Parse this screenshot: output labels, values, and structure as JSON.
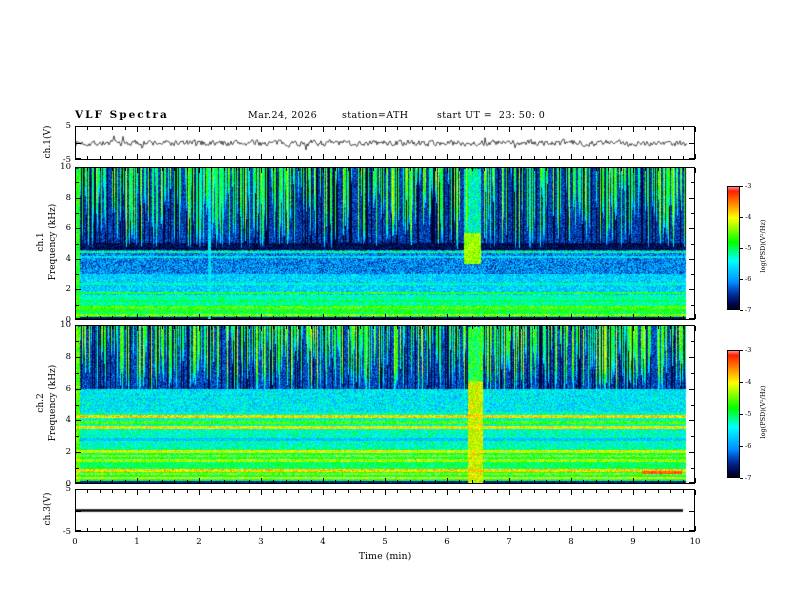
{
  "header": {
    "title": "VLF Spectra",
    "date": "Mar.24, 2026",
    "station": "station=ATH",
    "start_ut": "start UT =  23: 50: 0"
  },
  "axes": {
    "time": {
      "label": "Time (min)",
      "min": 0,
      "max": 10,
      "ticks": [
        0,
        1,
        2,
        3,
        4,
        5,
        6,
        7,
        8,
        9,
        10
      ]
    }
  },
  "colors": {
    "frame": "#000000",
    "background": "#ffffff"
  },
  "chart_data": [
    {
      "id": "ch1_waveform",
      "type": "line",
      "ylabel": "ch.1(V)",
      "ylim": [
        -5,
        5
      ],
      "yticks": [
        5,
        -5
      ],
      "line_color": "#000000",
      "line_width": 0.7,
      "noise_amplitude_v": 0.9,
      "spike_rate": 0.018,
      "spike_amplitude_v": 2.2,
      "seed": 7,
      "data_end_t": 9.9
    },
    {
      "id": "ch1_spectrogram",
      "type": "heatmap",
      "ylabel_lines": [
        "ch.1",
        "Frequency (kHz)"
      ],
      "ylim": [
        0,
        10
      ],
      "yticks": [
        10,
        8,
        6,
        4,
        2,
        0
      ],
      "colorbar": {
        "label": "log(PSD)(V²/Hz)",
        "ticks": [
          -3,
          -4,
          -5,
          -6,
          -7
        ],
        "min": -7,
        "max": -3
      },
      "seed": 11,
      "base_psd": -6.45,
      "noise": 0.3,
      "data_end_t": 9.87,
      "streaks": {
        "density": 0.5,
        "top": 10,
        "bottom_min": 4.7,
        "bottom_max": 9.2,
        "v_min": -5.3,
        "v_max": -4.2
      },
      "dark_columns": {
        "density": 0.22,
        "above_f": 5.05,
        "v": -6.9
      },
      "regions": [
        {
          "f0": 4.6,
          "f1": 5.05,
          "v": -6.8,
          "noise": 0.3
        },
        {
          "f0": 3.0,
          "f1": 4.6,
          "v": -6.1,
          "noise": 0.5
        },
        {
          "f0": 1.6,
          "f1": 3.0,
          "v": -5.7,
          "noise": 0.45
        },
        {
          "f0": 0.95,
          "f1": 1.6,
          "v": -5.25,
          "noise": 0.4
        },
        {
          "f0": 0.18,
          "f1": 0.95,
          "v": -5.0,
          "noise": 0.45
        },
        {
          "f0": 0.0,
          "f1": 0.18,
          "v": -6.8,
          "noise": 0.2
        }
      ],
      "bands": [
        {
          "f": 4.45,
          "w": 0.07,
          "v": -5.2,
          "jitter": 0.7
        },
        {
          "f": 4.12,
          "w": 0.06,
          "v": -5.6,
          "jitter": 0.5
        },
        {
          "f": 2.35,
          "w": 0.08,
          "v": -5.3,
          "jitter": 0.5
        },
        {
          "f": 1.75,
          "w": 0.08,
          "v": -4.8,
          "jitter": 0.45
        },
        {
          "f": 1.25,
          "w": 0.07,
          "v": -5.0,
          "jitter": 0.4
        },
        {
          "f": 0.8,
          "w": 0.08,
          "v": -4.6,
          "jitter": 0.4
        },
        {
          "f": 0.55,
          "w": 0.07,
          "v": -4.8,
          "jitter": 0.4
        },
        {
          "f": 0.3,
          "w": 0.08,
          "v": -4.4,
          "jitter": 0.4
        }
      ],
      "events": [
        {
          "t0": 6.27,
          "t1": 6.55,
          "f0": 3.7,
          "f1": 5.7,
          "v": -4.3,
          "jitter": 0.4
        },
        {
          "t0": 6.27,
          "t1": 6.55,
          "f0": 5.7,
          "f1": 10,
          "v": -5.4,
          "jitter": 0.6
        },
        {
          "t0": 0.0,
          "t1": 0.06,
          "f0": 0,
          "f1": 10,
          "v": -4.8,
          "jitter": 0.4
        },
        {
          "t0": 2.13,
          "t1": 2.17,
          "f0": 0,
          "f1": 10,
          "v": -5.6,
          "jitter": 0.4
        }
      ]
    },
    {
      "id": "ch2_spectrogram",
      "type": "heatmap",
      "ylabel_lines": [
        "ch.2",
        "Frequency (kHz)"
      ],
      "ylim": [
        0,
        10
      ],
      "yticks": [
        10,
        8,
        6,
        4,
        2,
        0
      ],
      "colorbar": {
        "label": "log(PSD)(V²/Hz)",
        "ticks": [
          -3,
          -4,
          -5,
          -6,
          -7
        ],
        "min": -7,
        "max": -3
      },
      "seed": 23,
      "base_psd": -6.4,
      "noise": 0.3,
      "data_end_t": 9.87,
      "streaks": {
        "density": 0.5,
        "top": 10,
        "bottom_min": 5.8,
        "bottom_max": 9.2,
        "v_min": -5.2,
        "v_max": -4.1
      },
      "dark_columns": {
        "density": 0.2,
        "above_f": 6.0,
        "v": -6.85
      },
      "regions": [
        {
          "f0": 2.72,
          "f1": 2.88,
          "v": -5.8,
          "noise": 0.3
        },
        {
          "f0": 4.55,
          "f1": 6.0,
          "v": -5.55,
          "noise": 0.5
        },
        {
          "f0": 2.2,
          "f1": 4.55,
          "v": -5.3,
          "noise": 0.45
        },
        {
          "f0": 0.95,
          "f1": 2.2,
          "v": -5.0,
          "noise": 0.4
        },
        {
          "f0": 0.18,
          "f1": 0.95,
          "v": -4.95,
          "noise": 0.45
        },
        {
          "f0": 0.0,
          "f1": 0.18,
          "v": -6.6,
          "noise": 0.25
        }
      ],
      "bands": [
        {
          "f": 4.25,
          "w": 0.1,
          "v": -3.9,
          "jitter": 0.4
        },
        {
          "f": 3.9,
          "w": 0.08,
          "v": -4.6,
          "jitter": 0.4
        },
        {
          "f": 3.55,
          "w": 0.1,
          "v": -4.0,
          "jitter": 0.4
        },
        {
          "f": 2.05,
          "w": 0.1,
          "v": -4.1,
          "jitter": 0.4
        },
        {
          "f": 1.75,
          "w": 0.08,
          "v": -4.4,
          "jitter": 0.4
        },
        {
          "f": 1.45,
          "w": 0.08,
          "v": -4.3,
          "jitter": 0.4
        },
        {
          "f": 0.85,
          "w": 0.09,
          "v": -3.9,
          "jitter": 0.4
        },
        {
          "f": 0.6,
          "w": 0.07,
          "v": -4.4,
          "jitter": 0.4
        },
        {
          "f": 0.35,
          "w": 0.09,
          "v": -4.1,
          "jitter": 0.4
        },
        {
          "f": 0.7,
          "w": 0.12,
          "v": -3.3,
          "jitter": 0.3,
          "t0": 9.15,
          "t1": 9.8
        }
      ],
      "events": [
        {
          "t0": 6.33,
          "t1": 6.58,
          "f0": 0,
          "f1": 6.5,
          "v": -4.1,
          "jitter": 0.5
        },
        {
          "t0": 6.33,
          "t1": 6.58,
          "f0": 6.5,
          "f1": 10,
          "v": -4.9,
          "jitter": 0.6
        },
        {
          "t0": 0.0,
          "t1": 0.06,
          "f0": 0,
          "f1": 10,
          "v": -4.6,
          "jitter": 0.4
        }
      ]
    },
    {
      "id": "ch3_waveform",
      "type": "line",
      "ylabel": "ch.3(V)",
      "ylim": [
        -5,
        5
      ],
      "yticks": [
        5,
        -5
      ],
      "line_color": "#000000",
      "line_width": 2.5,
      "noise_amplitude_v": 0,
      "spike_rate": 0,
      "spike_amplitude_v": 0,
      "seed": 3,
      "data_end_t": 9.83
    }
  ]
}
